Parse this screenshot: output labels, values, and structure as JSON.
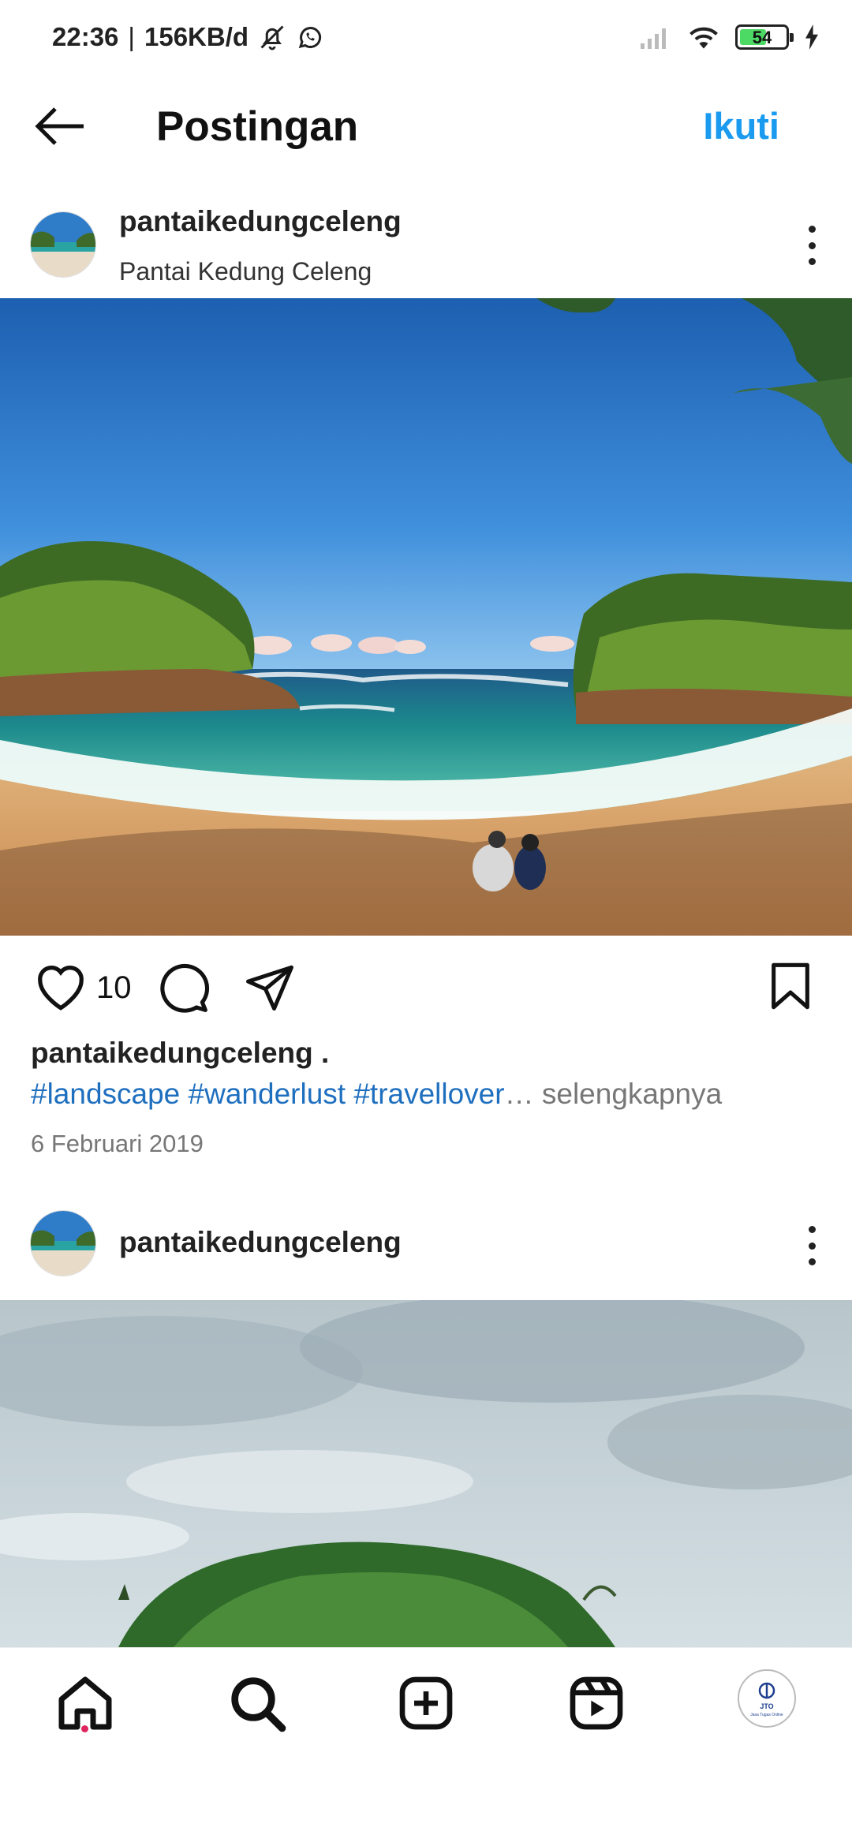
{
  "status": {
    "time": "22:36",
    "network_speed": "156KB/d",
    "battery": "54",
    "battery_level": 0.54,
    "icons": [
      "bell-off-icon",
      "whatsapp-icon",
      "signal-icon",
      "wifi-icon",
      "battery-icon",
      "charging-icon"
    ]
  },
  "header": {
    "title": "Postingan",
    "follow_label": "Ikuti",
    "accent": "#1a9bf0"
  },
  "post1": {
    "username": "pantaikedungceleng",
    "location": "Pantai Kedung Celeng",
    "likes": "10",
    "caption_user": "pantaikedungceleng .",
    "hashtags": "#landscape #wanderlust #travellover",
    "ellipsis": "…",
    "more_label": " selengkapnya",
    "date": "6 Februari 2019"
  },
  "post2": {
    "username": "pantaikedungceleng"
  },
  "nav": {
    "items": [
      "home-icon",
      "search-icon",
      "create-icon",
      "reels-icon",
      "profile-avatar"
    ],
    "profile_logo_text": "JTO",
    "profile_logo_sub": "Jasa Tugas Online"
  }
}
